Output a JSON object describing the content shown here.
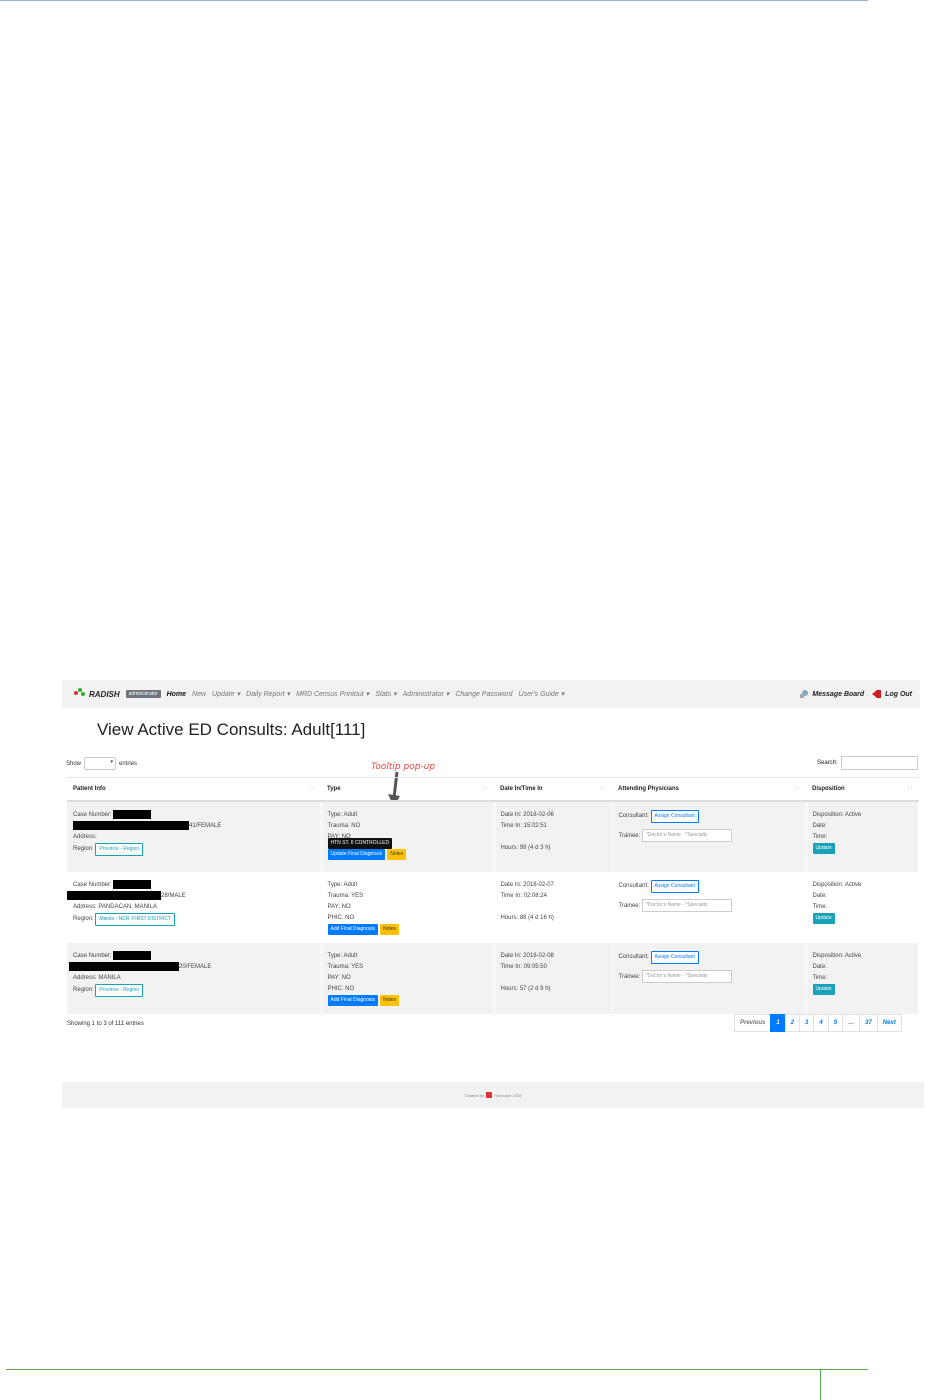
{
  "navbar": {
    "brand": "RADISH",
    "badge": "administrator",
    "items": [
      {
        "label": "Home"
      },
      {
        "label": "New"
      },
      {
        "label": "Update ▾"
      },
      {
        "label": "Daily Report ▾"
      },
      {
        "label": "MRD Census Printout ▾"
      },
      {
        "label": "Stats ▾"
      },
      {
        "label": "Administrator ▾"
      },
      {
        "label": "Change Password"
      },
      {
        "label": "User's Guide ▾"
      }
    ],
    "message_board": "Message Board",
    "log_out": "Log Out"
  },
  "page_title": "View Active ED Consults: Adult[111]",
  "controls": {
    "show_label": "Show",
    "entries_label": "entries",
    "search_label": "Search:"
  },
  "annotation": "Tooltip pop-up",
  "columns": [
    "Patient Info",
    "Type",
    "Date In/Time In",
    "Attending Physicians",
    "Disposition"
  ],
  "rows": [
    {
      "case_label": "Case Number:",
      "age_sex": "41/FEMALE",
      "address": "Address:",
      "region_label": "Region:",
      "region_value": "Province - Region",
      "type": "Type: Adult",
      "trauma": "Trauma: NO",
      "pay": "PAY: NO",
      "tooltip": "HTN ST. II CONTROLLED",
      "diagnosis_btn": "Update Final Diagnosis",
      "notes_btn": "Notes",
      "date_in": "Date In: 2018-02-06",
      "time_in": "Time In: 15:02:51",
      "hours": "Hours: 99 (4 d 3 h)",
      "consultant_label": "Consultant:",
      "assign_btn": "Assign Consultant",
      "trainee_label": "Trainee:",
      "trainee_placeholder": "*Doctor's Name - *Specialty",
      "disposition": "Disposition: Active",
      "date": "Date:",
      "time": "Time:",
      "update_btn": "Update"
    },
    {
      "case_label": "Case Number:",
      "age_sex": "28/MALE",
      "address": "Address: PANDACAN, MANILA",
      "region_label": "Region:",
      "region_value": "Manila - NCR, FIRST DISTRICT",
      "type": "Type: Adult",
      "trauma": "Trauma: YES",
      "pay": "PAY: NO",
      "phic": "PHIC: NO",
      "diagnosis_btn": "Add Final Diagnosis",
      "notes_btn": "Notes",
      "date_in": "Date In: 2018-02-07",
      "time_in": "Time In: 02:08:24",
      "hours": "Hours: 88 (4 d 16 h)",
      "consultant_label": "Consultant:",
      "assign_btn": "Assign Consultant",
      "trainee_label": "Trainee:",
      "trainee_placeholder": "*Doctor's Name - *Specialty",
      "disposition": "Disposition: Active",
      "date": "Date:",
      "time": "Time:",
      "update_btn": "Update"
    },
    {
      "case_label": "Case Number:",
      "age_sex": "20/FEMALE",
      "address": "Address: MANILA",
      "region_label": "Region:",
      "region_value": "Province - Region",
      "type": "Type: Adult",
      "trauma": "Trauma: YES",
      "pay": "PAY: NO",
      "phic": "PHIC: NO",
      "diagnosis_btn": "Add Final Diagnosis",
      "notes_btn": "Notes",
      "date_in": "Date In: 2018-02-08",
      "time_in": "Time In: 09:05:50",
      "hours": "Hours: 57 (2 d 9 h)",
      "consultant_label": "Consultant:",
      "assign_btn": "Assign Consultant",
      "trainee_label": "Trainee:",
      "trainee_placeholder": "*Doctor's Name - *Specialty",
      "disposition": "Disposition: Active",
      "date": "Date:",
      "time": "Time:",
      "update_btn": "Update"
    }
  ],
  "footer": {
    "showing": "Showing 1 to 3 of 111 entries",
    "pagination": [
      "Previous",
      "1",
      "2",
      "3",
      "4",
      "5",
      "…",
      "37",
      "Next"
    ],
    "credit_prefix": "Created by",
    "credit_suffix": "Hurricane 2018"
  }
}
